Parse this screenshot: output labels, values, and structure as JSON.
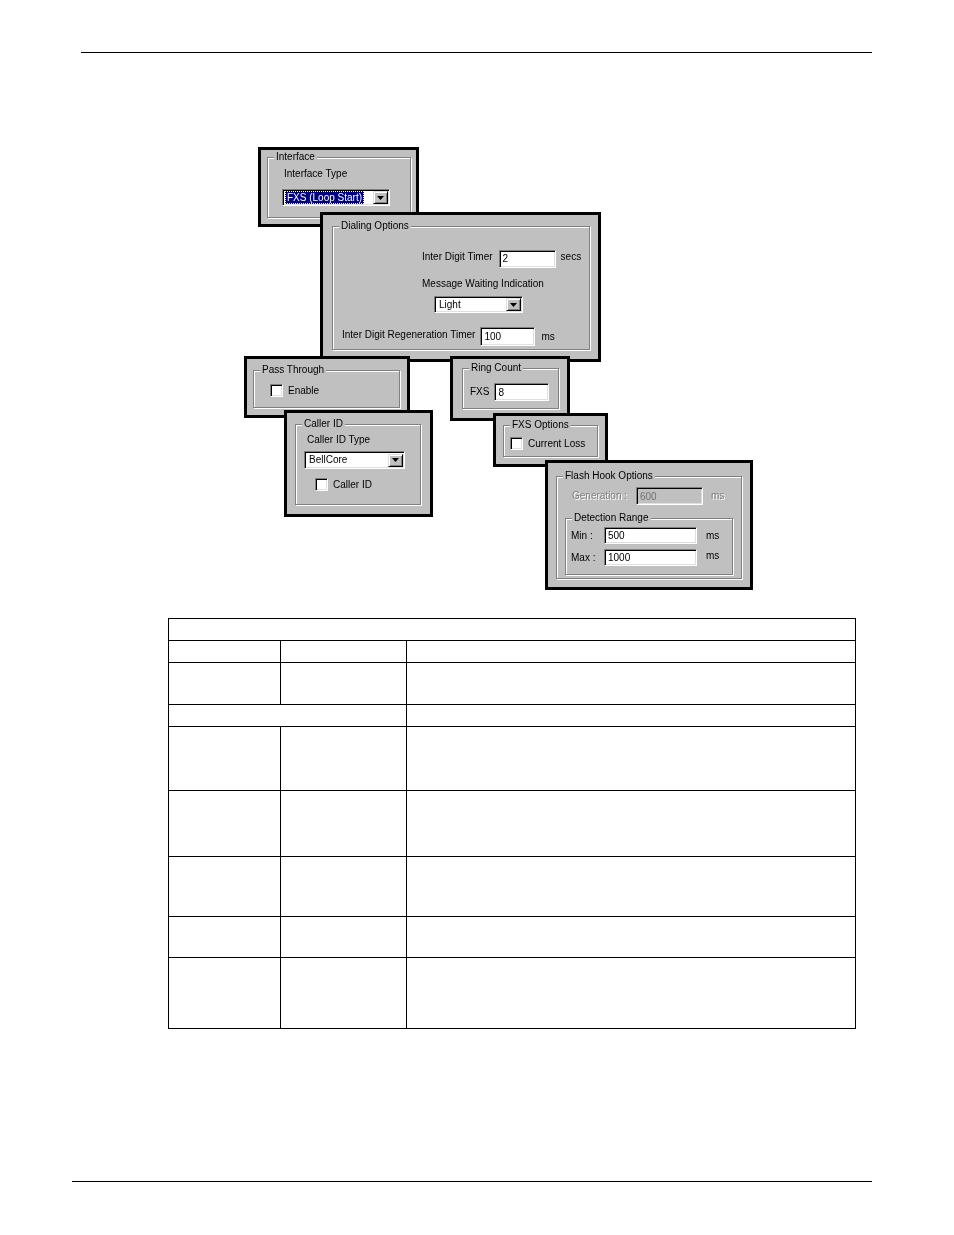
{
  "interface": {
    "title": "Interface",
    "type_label": "Interface Type",
    "type": {
      "value": "FXS (Loop Start)",
      "focused": true
    }
  },
  "dialing_options": {
    "title": "Dialing Options",
    "inter_digit_timer": {
      "label": "Inter Digit Timer",
      "value": "2",
      "unit": "secs"
    },
    "message_waiting_indication": {
      "label": "Message Waiting Indication",
      "value": "Light",
      "focused": false
    },
    "inter_digit_regeneration_timer": {
      "label": "Inter Digit Regeneration Timer",
      "value": "100",
      "unit": "ms"
    }
  },
  "pass_through": {
    "title": "Pass Through",
    "enable": {
      "label": "Enable",
      "checked": false
    }
  },
  "ring_count": {
    "title": "Ring Count",
    "fxs": {
      "label": "FXS",
      "value": "8"
    }
  },
  "caller_id": {
    "title": "Caller ID",
    "type_label": "Caller ID Type",
    "type": {
      "value": "BellCore",
      "focused": false
    },
    "caller_id": {
      "label": "Caller ID",
      "checked": false
    }
  },
  "fxs_options": {
    "title": "FXS Options",
    "current_loss": {
      "label": "Current Loss",
      "checked": false
    }
  },
  "flash_hook_options": {
    "title": "Flash Hook Options",
    "generation": {
      "label": "Generation :",
      "value": "600",
      "unit": "ms",
      "disabled": true
    },
    "detection_range": {
      "title": "Detection Range",
      "min": {
        "label": "Min :",
        "value": "500",
        "unit": "ms"
      },
      "max": {
        "label": "Max :",
        "value": "1000",
        "unit": "ms"
      }
    }
  },
  "table": {
    "rows": [
      {
        "kind": "full"
      },
      {
        "kind": "split"
      },
      {
        "kind": "split"
      },
      {
        "kind": "merged"
      },
      {
        "kind": "split"
      },
      {
        "kind": "split"
      },
      {
        "kind": "split"
      },
      {
        "kind": "split"
      },
      {
        "kind": "split"
      }
    ]
  }
}
